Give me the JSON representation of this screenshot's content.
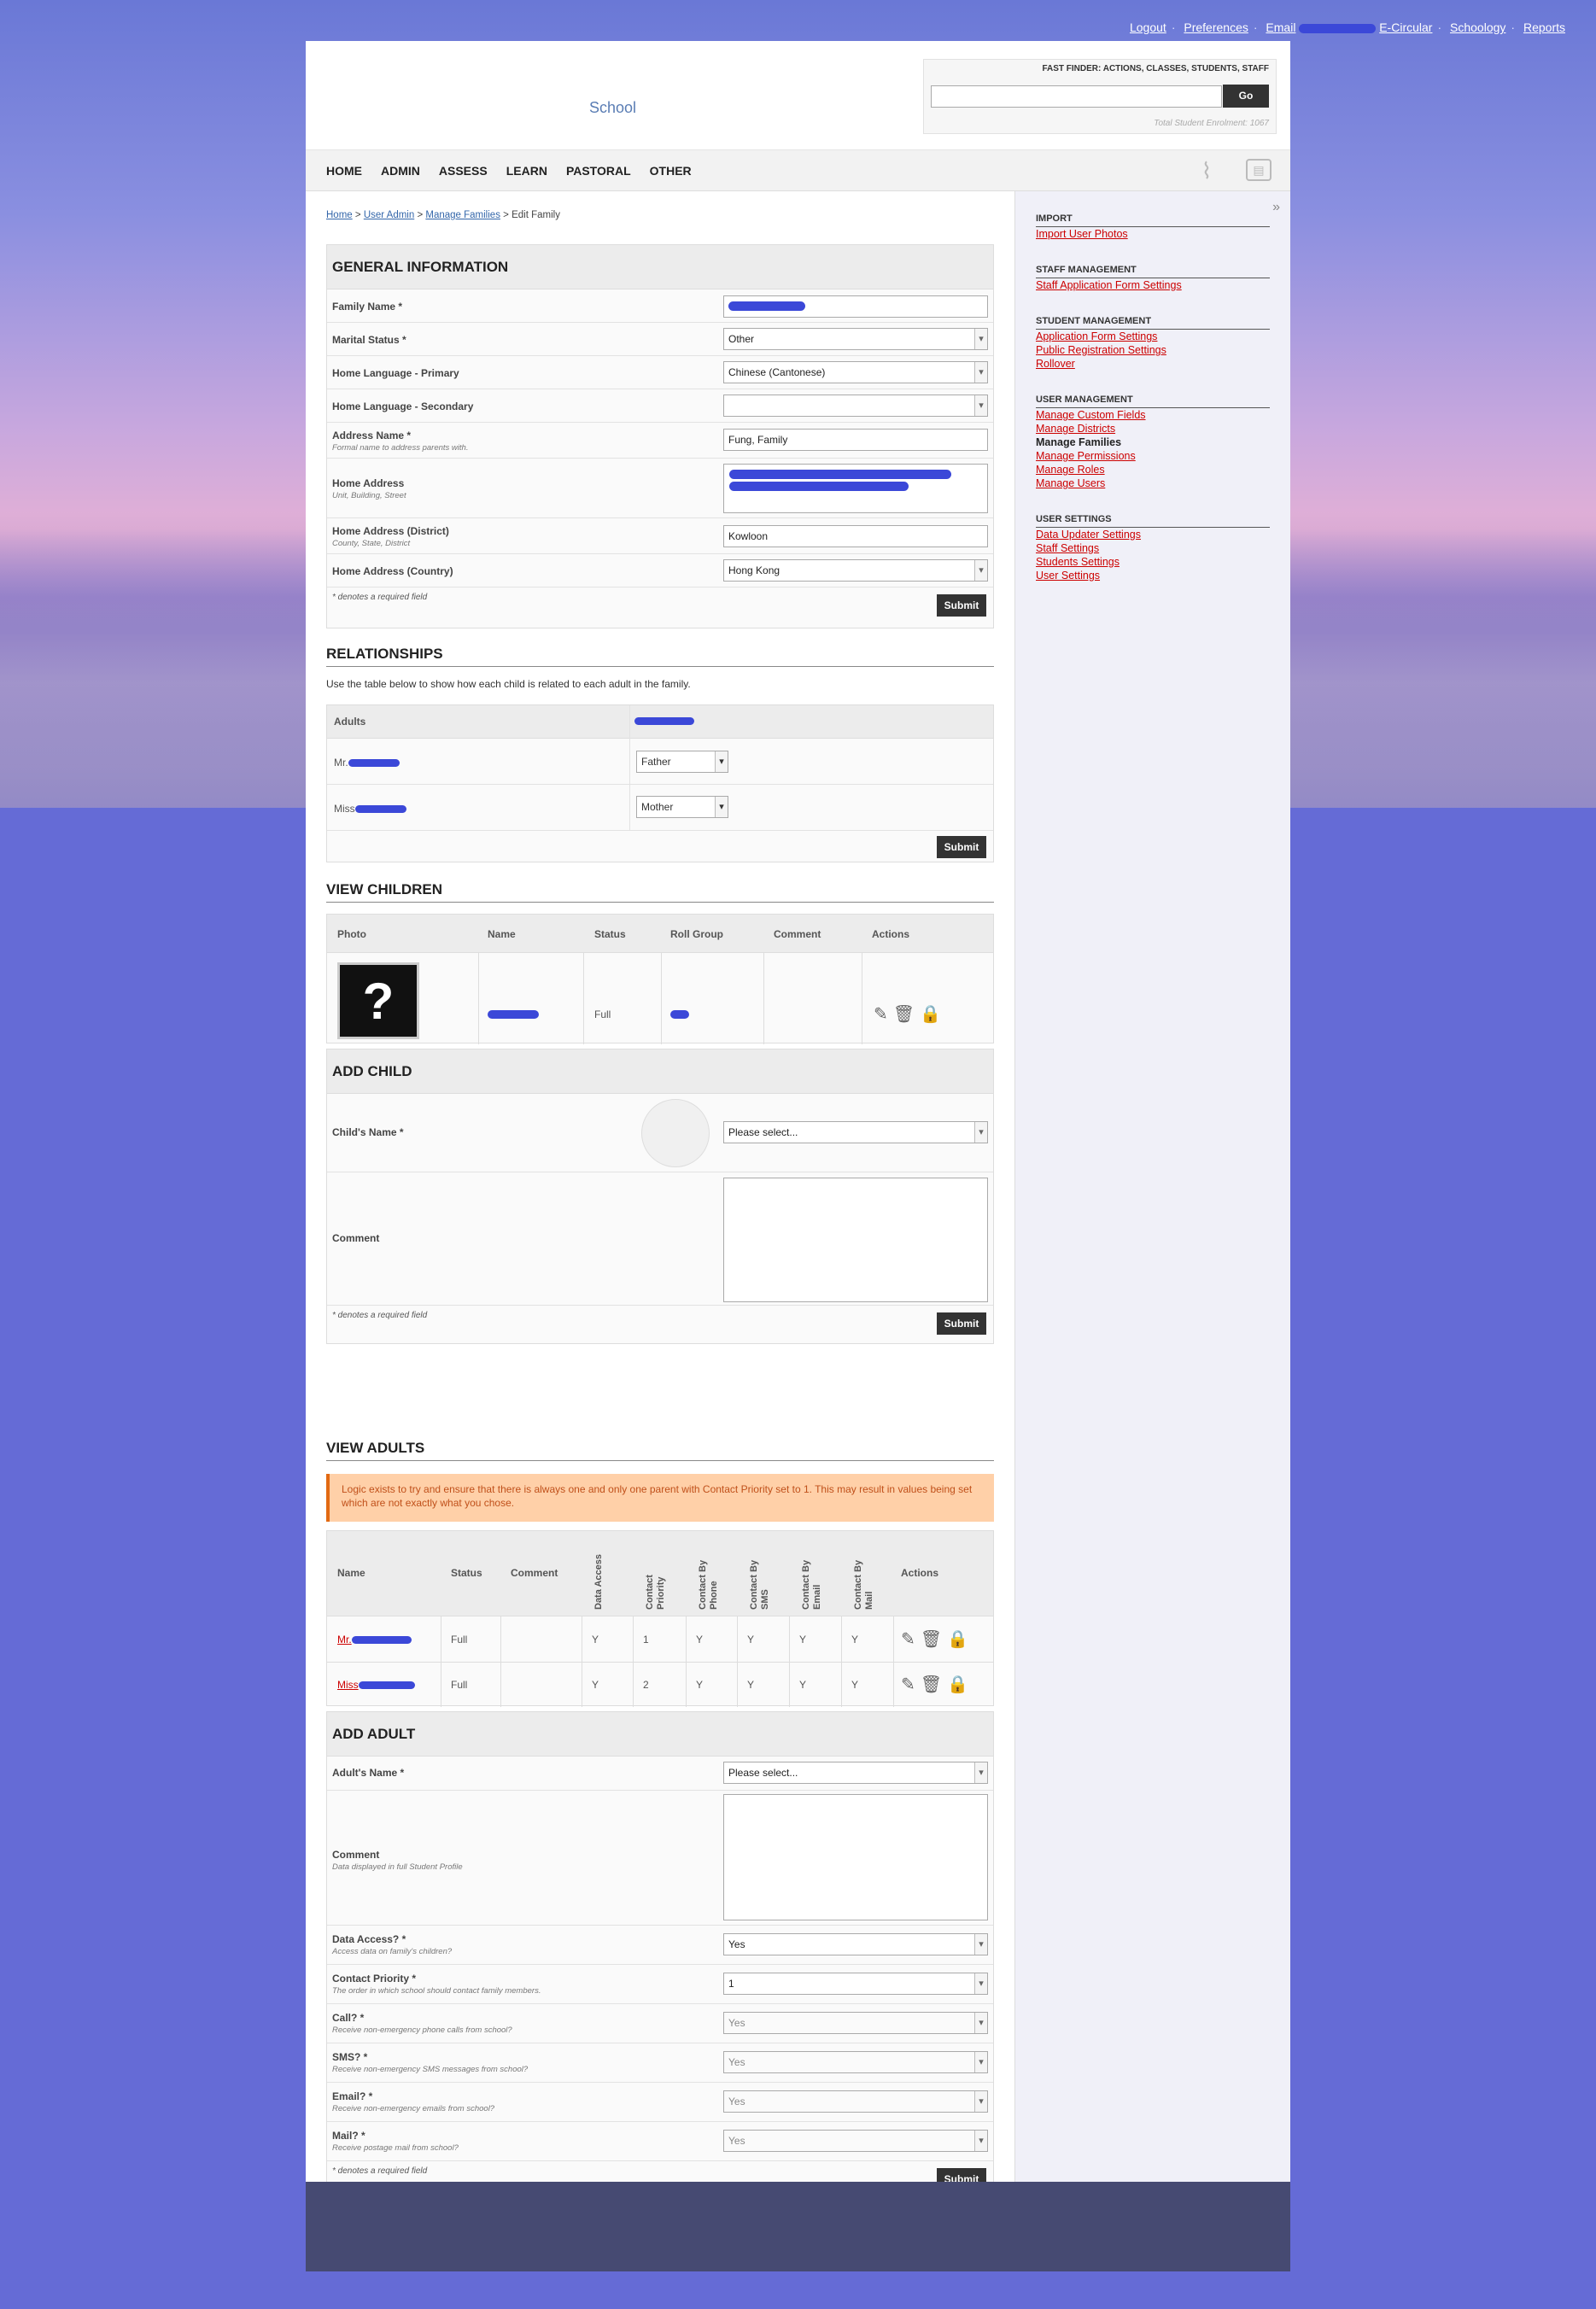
{
  "toplinks": {
    "logout": "Logout",
    "preferences": "Preferences",
    "email": "Email",
    "ecircular": "E-Circular",
    "schoology": "Schoology",
    "reports": "Reports"
  },
  "header": {
    "logo": "School",
    "fastfinder_title": "FAST FINDER: ACTIONS, CLASSES, STUDENTS, STAFF",
    "go": "Go",
    "enrolment": "Total Student Enrolment: 1067"
  },
  "nav": [
    "HOME",
    "ADMIN",
    "ASSESS",
    "LEARN",
    "PASTORAL",
    "OTHER"
  ],
  "breadcrumb": {
    "home": "Home",
    "useradmin": "User Admin",
    "families": "Manage Families",
    "current": "> Edit Family",
    "sep": ">"
  },
  "general": {
    "title": "GENERAL INFORMATION",
    "family_name": "Family Name *",
    "marital": "Marital Status *",
    "marital_val": "Other",
    "lang1": "Home Language - Primary",
    "lang1_val": "Chinese (Cantonese)",
    "lang2": "Home Language - Secondary",
    "lang2_val": "",
    "addrname": "Address Name *",
    "addrname_sub": "Formal name to address parents with.",
    "addrname_val": "Fung, Family",
    "homeaddr": "Home Address",
    "homeaddr_sub": "Unit, Building, Street",
    "district": "Home Address (District)",
    "district_sub": "County, State, District",
    "district_val": "Kowloon",
    "country": "Home Address (Country)",
    "country_val": "Hong Kong",
    "required": "* denotes a required field",
    "submit": "Submit"
  },
  "relationships": {
    "title": "RELATIONSHIPS",
    "desc": "Use the table below to show how each child is related to each adult in the family.",
    "adults": "Adults",
    "adult1": "Mr.",
    "adult2": "Miss",
    "rel1": "Father",
    "rel2": "Mother",
    "submit": "Submit"
  },
  "children": {
    "title": "VIEW CHILDREN",
    "cols": [
      "Photo",
      "Name",
      "Status",
      "Roll Group",
      "Comment",
      "Actions"
    ],
    "status": "Full"
  },
  "addchild": {
    "title": "ADD CHILD",
    "name": "Child's Name *",
    "select": "Please select...",
    "comment": "Comment",
    "required": "* denotes a required field",
    "submit": "Submit"
  },
  "adults": {
    "title": "VIEW ADULTS",
    "warning": "Logic exists to try and ensure that there is always one and only one parent with Contact Priority set to 1. This may result in values being set which are not exactly what you chose.",
    "cols": [
      "Name",
      "Status",
      "Comment",
      "Data Access",
      "Contact Priority",
      "Contact By Phone",
      "Contact By SMS",
      "Contact By Email",
      "Contact By Mail",
      "Actions"
    ],
    "rows": [
      {
        "name": "Mr.",
        "status": "Full",
        "access": "Y",
        "priority": "1",
        "phone": "Y",
        "sms": "Y",
        "email": "Y",
        "mail": "Y"
      },
      {
        "name": "Miss",
        "status": "Full",
        "access": "Y",
        "priority": "2",
        "phone": "Y",
        "sms": "Y",
        "email": "Y",
        "mail": "Y"
      }
    ]
  },
  "addadult": {
    "title": "ADD ADULT",
    "name": "Adult's Name *",
    "select": "Please select...",
    "comment": "Comment",
    "comment_sub": "Data displayed in full Student Profile",
    "access": "Data Access? *",
    "access_sub": "Access data on family's children?",
    "access_val": "Yes",
    "priority": "Contact Priority *",
    "priority_sub": "The order in which school should contact family members.",
    "priority_val": "1",
    "call": "Call? *",
    "call_sub": "Receive non-emergency phone calls from school?",
    "call_val": "Yes",
    "sms": "SMS? *",
    "sms_sub": "Receive non-emergency SMS messages from school?",
    "sms_val": "Yes",
    "email": "Email? *",
    "email_sub": "Receive non-emergency emails from school?",
    "email_val": "Yes",
    "mail": "Mail? *",
    "mail_sub": "Receive postage mail from school?",
    "mail_val": "Yes",
    "required": "* denotes a required field",
    "submit": "Submit"
  },
  "sidebar": {
    "import": "IMPORT",
    "import_photos": "Import User Photos",
    "staff": "STAFF MANAGEMENT",
    "staff_app": "Staff Application Form Settings",
    "student": "STUDENT MANAGEMENT",
    "student_app": "Application Form Settings",
    "public_reg": "Public Registration Settings",
    "rollover": "Rollover",
    "user": "USER MANAGEMENT",
    "custom": "Manage Custom Fields",
    "districts": "Manage Districts",
    "families": "Manage Families",
    "permissions": "Manage Permissions",
    "roles": "Manage Roles",
    "users": "Manage Users",
    "settings": "USER SETTINGS",
    "data_updater": "Data Updater Settings",
    "staff_settings": "Staff Settings",
    "students_settings": "Students Settings",
    "user_settings": "User Settings"
  }
}
